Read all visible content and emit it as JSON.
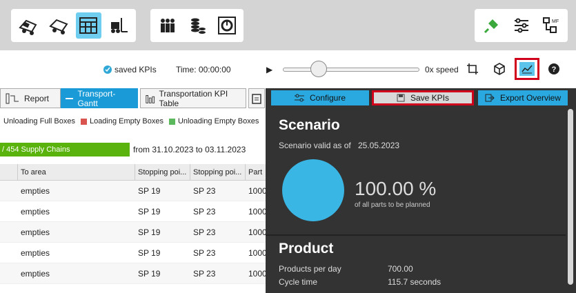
{
  "toolbar": {
    "left_icons": [
      "truck-loaded-icon",
      "truck-empty-icon",
      "gantt-table-icon",
      "forklift-icon"
    ],
    "mid_icons": [
      "people-icon",
      "coins-stack-icon",
      "cycle-timer-icon"
    ],
    "right_icons": [
      "plug-icon",
      "sliders-icon",
      "mf-structure-icon"
    ]
  },
  "status": {
    "saved_label": "saved KPIs",
    "time_label": "Time: 00:00:00",
    "play_symbol": "▶",
    "speed_label": "0x speed",
    "slider_value": 0.2
  },
  "tabs": [
    {
      "label": "Report",
      "icon": "report-icon"
    },
    {
      "label": "Transport-Gantt",
      "icon": "gantt-icon"
    },
    {
      "label": "Transportation KPI Table",
      "icon": "bar-chart-icon"
    }
  ],
  "legend": [
    {
      "label": "Unloading Full Boxes",
      "color": null
    },
    {
      "label": "Loading Empty Boxes",
      "color": "#d9534f"
    },
    {
      "label": "Unloading Empty Boxes",
      "color": "#5cb85c"
    }
  ],
  "progress": {
    "label": "/ 454 Supply Chains",
    "color": "#5ab30c"
  },
  "date_range": "from 31.10.2023 to 03.11.2023",
  "table": {
    "headers": [
      "To area",
      "Stopping poi...",
      "Stopping poi...",
      "Part"
    ],
    "rows": [
      [
        "empties",
        "SP 19",
        "SP 23",
        "1000"
      ],
      [
        "empties",
        "SP 19",
        "SP 23",
        "1000"
      ],
      [
        "empties",
        "SP 19",
        "SP 23",
        "1000"
      ],
      [
        "empties",
        "SP 19",
        "SP 23",
        "1000"
      ],
      [
        "empties",
        "SP 19",
        "SP 23",
        "1000"
      ]
    ]
  },
  "panel": {
    "configure_label": "Configure",
    "save_label": "Save KPIs",
    "export_label": "Export Overview",
    "scenario_title": "Scenario",
    "scenario_valid_label": "Scenario valid as of",
    "scenario_date": "25.05.2023",
    "pct_value": "100.00 %",
    "pct_sub": "of all parts to be planned",
    "pie_color": "#3ab6e5",
    "product_title": "Product",
    "products_per_day_label": "Products per day",
    "products_per_day_value": "700.00",
    "cycle_time_label": "Cycle time",
    "cycle_time_value": "115.7 seconds"
  }
}
